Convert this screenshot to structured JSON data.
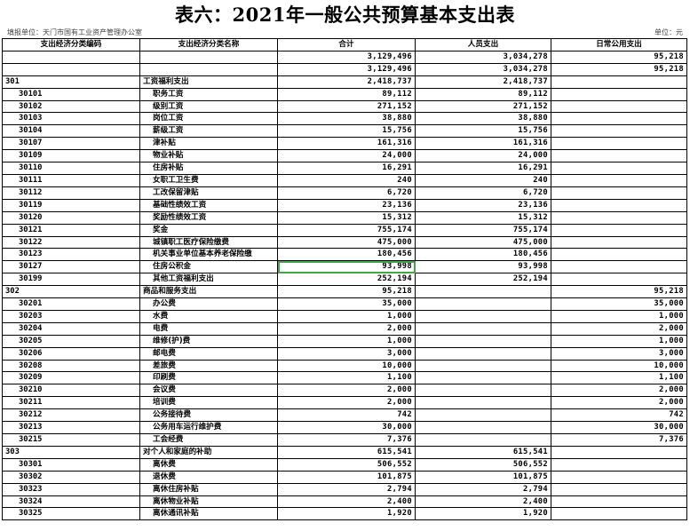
{
  "header": {
    "title": "表六：2021年一般公共预算基本支出表",
    "unit_left": "填报单位：天门市国有工业资产管理办公室",
    "unit_right": "单位：元"
  },
  "columns": [
    "支出经济分类编码",
    "支出经济分类名称",
    "合计",
    "人员支出",
    "日常公用支出"
  ],
  "rows": [
    {
      "code": "",
      "name": "",
      "total": "3,129,496",
      "personnel": "3,034,278",
      "public": "95,218",
      "level": 0
    },
    {
      "code": "",
      "name": "",
      "total": "3,129,496",
      "personnel": "3,034,278",
      "public": "95,218",
      "level": 0
    },
    {
      "code": "301",
      "name": "工资福利支出",
      "total": "2,418,737",
      "personnel": "2,418,737",
      "public": "",
      "level": 1
    },
    {
      "code": "30101",
      "name": "职务工资",
      "total": "89,112",
      "personnel": "89,112",
      "public": "",
      "level": 2
    },
    {
      "code": "30102",
      "name": "级别工资",
      "total": "271,152",
      "personnel": "271,152",
      "public": "",
      "level": 2
    },
    {
      "code": "30103",
      "name": "岗位工资",
      "total": "38,880",
      "personnel": "38,880",
      "public": "",
      "level": 2
    },
    {
      "code": "30104",
      "name": "薪级工资",
      "total": "15,756",
      "personnel": "15,756",
      "public": "",
      "level": 2
    },
    {
      "code": "30107",
      "name": "津补贴",
      "total": "161,316",
      "personnel": "161,316",
      "public": "",
      "level": 2
    },
    {
      "code": "30109",
      "name": "物业补贴",
      "total": "24,000",
      "personnel": "24,000",
      "public": "",
      "level": 2
    },
    {
      "code": "30110",
      "name": "住房补贴",
      "total": "16,291",
      "personnel": "16,291",
      "public": "",
      "level": 2
    },
    {
      "code": "30111",
      "name": "女职工卫生费",
      "total": "240",
      "personnel": "240",
      "public": "",
      "level": 2
    },
    {
      "code": "30112",
      "name": "工改保留津贴",
      "total": "6,720",
      "personnel": "6,720",
      "public": "",
      "level": 2
    },
    {
      "code": "30119",
      "name": "基础性绩效工资",
      "total": "23,136",
      "personnel": "23,136",
      "public": "",
      "level": 2
    },
    {
      "code": "30120",
      "name": "奖励性绩效工资",
      "total": "15,312",
      "personnel": "15,312",
      "public": "",
      "level": 2
    },
    {
      "code": "30121",
      "name": "奖金",
      "total": "755,174",
      "personnel": "755,174",
      "public": "",
      "level": 2
    },
    {
      "code": "30122",
      "name": "城镇职工医疗保险缴费",
      "total": "475,000",
      "personnel": "475,000",
      "public": "",
      "level": 2
    },
    {
      "code": "30123",
      "name": "机关事业单位基本养老保险缴",
      "total": "180,456",
      "personnel": "180,456",
      "public": "",
      "level": 2
    },
    {
      "code": "30127",
      "name": "住房公积金",
      "total": "93,998",
      "personnel": "93,998",
      "public": "",
      "level": 2,
      "selected": true
    },
    {
      "code": "30199",
      "name": "其他工资福利支出",
      "total": "252,194",
      "personnel": "252,194",
      "public": "",
      "level": 2
    },
    {
      "code": "302",
      "name": "商品和服务支出",
      "total": "95,218",
      "personnel": "",
      "public": "95,218",
      "level": 1
    },
    {
      "code": "30201",
      "name": "办公费",
      "total": "35,000",
      "personnel": "",
      "public": "35,000",
      "level": 2
    },
    {
      "code": "30203",
      "name": "水费",
      "total": "1,000",
      "personnel": "",
      "public": "1,000",
      "level": 2
    },
    {
      "code": "30204",
      "name": "电费",
      "total": "2,000",
      "personnel": "",
      "public": "2,000",
      "level": 2
    },
    {
      "code": "30205",
      "name": "维修(护)费",
      "total": "1,000",
      "personnel": "",
      "public": "1,000",
      "level": 2
    },
    {
      "code": "30206",
      "name": "邮电费",
      "total": "3,000",
      "personnel": "",
      "public": "3,000",
      "level": 2
    },
    {
      "code": "30208",
      "name": "差旅费",
      "total": "10,000",
      "personnel": "",
      "public": "10,000",
      "level": 2
    },
    {
      "code": "30209",
      "name": "印刷费",
      "total": "1,100",
      "personnel": "",
      "public": "1,100",
      "level": 2
    },
    {
      "code": "30210",
      "name": "会议费",
      "total": "2,000",
      "personnel": "",
      "public": "2,000",
      "level": 2
    },
    {
      "code": "30211",
      "name": "培训费",
      "total": "2,000",
      "personnel": "",
      "public": "2,000",
      "level": 2
    },
    {
      "code": "30212",
      "name": "公务接待费",
      "total": "742",
      "personnel": "",
      "public": "742",
      "level": 2
    },
    {
      "code": "30213",
      "name": "公务用车运行维护费",
      "total": "30,000",
      "personnel": "",
      "public": "30,000",
      "level": 2
    },
    {
      "code": "30215",
      "name": "工会经费",
      "total": "7,376",
      "personnel": "",
      "public": "7,376",
      "level": 2
    },
    {
      "code": "303",
      "name": "对个人和家庭的补助",
      "total": "615,541",
      "personnel": "615,541",
      "public": "",
      "level": 1
    },
    {
      "code": "30301",
      "name": "离休费",
      "total": "506,552",
      "personnel": "506,552",
      "public": "",
      "level": 2
    },
    {
      "code": "30302",
      "name": "退休费",
      "total": "101,875",
      "personnel": "101,875",
      "public": "",
      "level": 2
    },
    {
      "code": "30323",
      "name": "离休住房补贴",
      "total": "2,794",
      "personnel": "2,794",
      "public": "",
      "level": 2
    },
    {
      "code": "30324",
      "name": "离休物业补贴",
      "total": "2,400",
      "personnel": "2,400",
      "public": "",
      "level": 2
    },
    {
      "code": "30325",
      "name": "离休通讯补贴",
      "total": "1,920",
      "personnel": "1,920",
      "public": "",
      "level": 2
    }
  ]
}
